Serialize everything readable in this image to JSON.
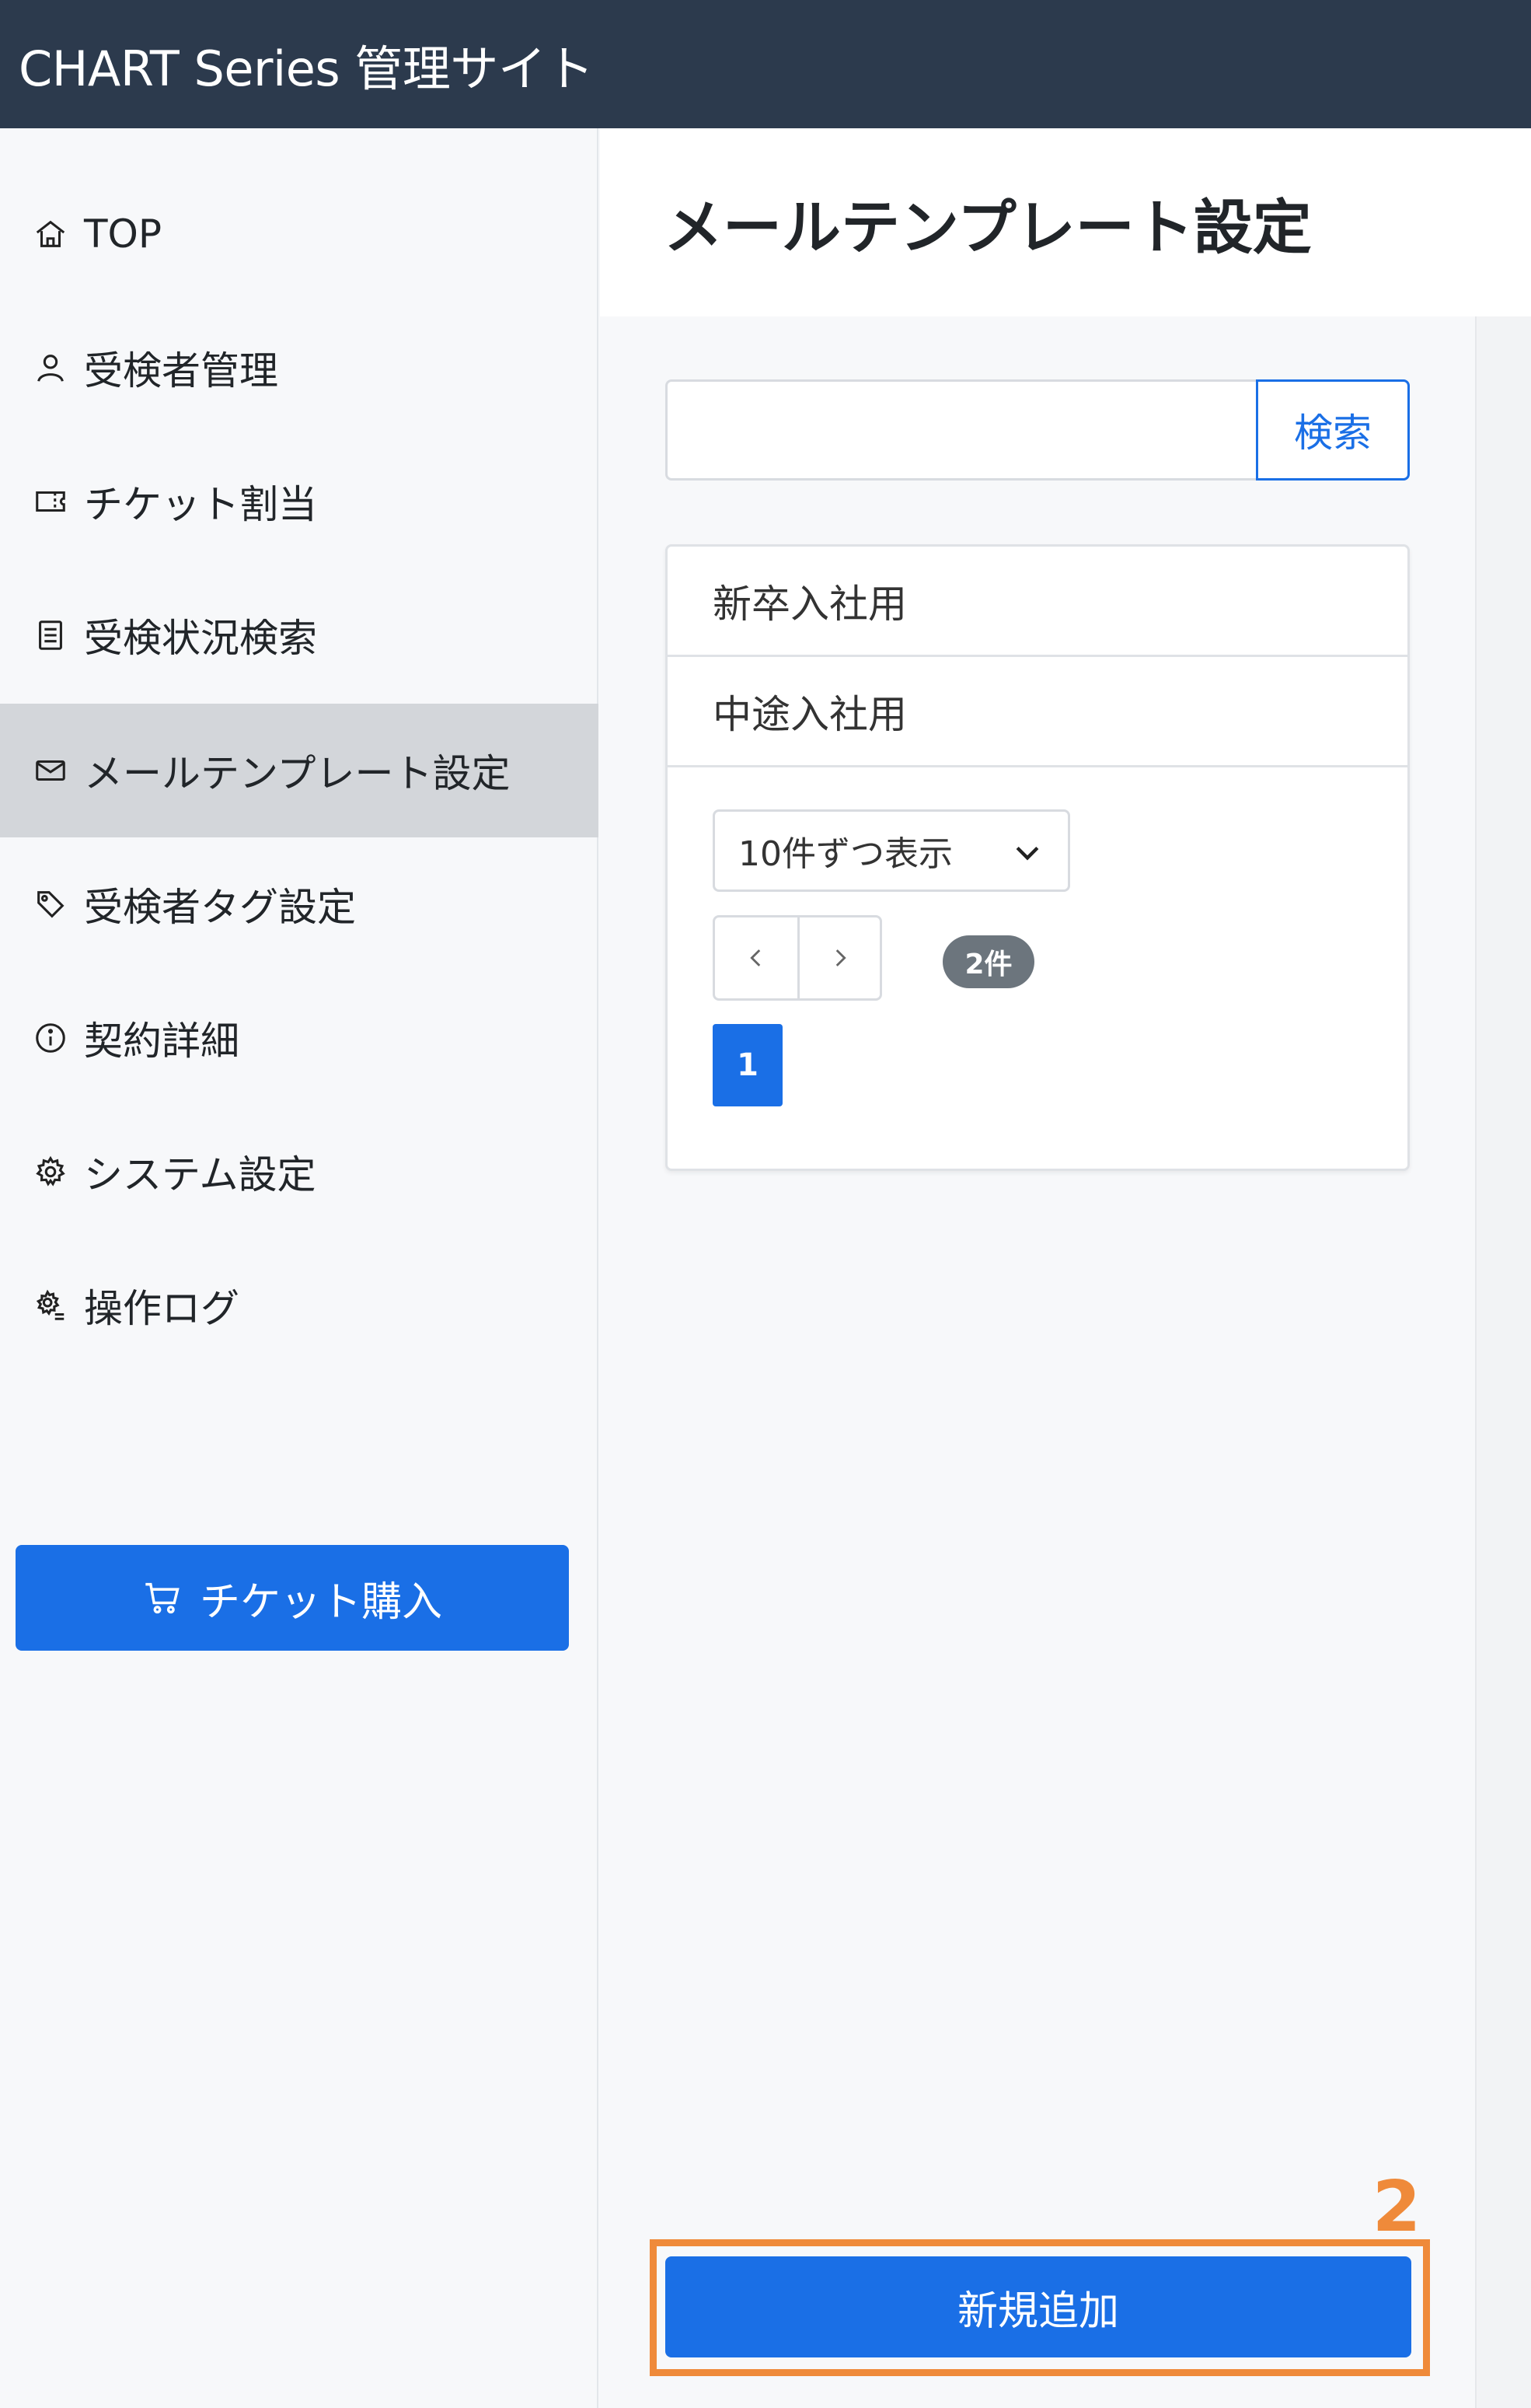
{
  "app": {
    "title": "CHART Series 管理サイト"
  },
  "sidebar": {
    "items": [
      {
        "label": "TOP",
        "icon": "home-icon"
      },
      {
        "label": "受検者管理",
        "icon": "user-icon"
      },
      {
        "label": "チケット割当",
        "icon": "ticket-icon"
      },
      {
        "label": "受検状況検索",
        "icon": "document-list-icon"
      },
      {
        "label": "メールテンプレート設定",
        "icon": "mail-icon",
        "active": true
      },
      {
        "label": "受検者タグ設定",
        "icon": "tag-icon"
      },
      {
        "label": "契約詳細",
        "icon": "info-icon"
      },
      {
        "label": "システム設定",
        "icon": "gear-icon"
      },
      {
        "label": "操作ログ",
        "icon": "gear-list-icon"
      }
    ],
    "buy_button": {
      "label": "チケット購入",
      "icon": "cart-icon"
    }
  },
  "main": {
    "page_title": "メールテンプレート設定",
    "search": {
      "value": "",
      "placeholder": "",
      "button_label": "検索"
    },
    "templates": [
      {
        "name": "新卒入社用"
      },
      {
        "name": "中途入社用"
      }
    ],
    "page_size": {
      "selected": "10件ずつ表示"
    },
    "pagination": {
      "count_label": "2件",
      "current_page": "1"
    },
    "add_button": {
      "label": "新規追加"
    },
    "annotation": {
      "step": "2"
    }
  },
  "colors": {
    "header_bg": "#2c3a4d",
    "primary": "#1a6fe6",
    "active_nav_bg": "#d3d6da",
    "annotation": "#ef8a3a",
    "badge_bg": "#6c757d"
  }
}
